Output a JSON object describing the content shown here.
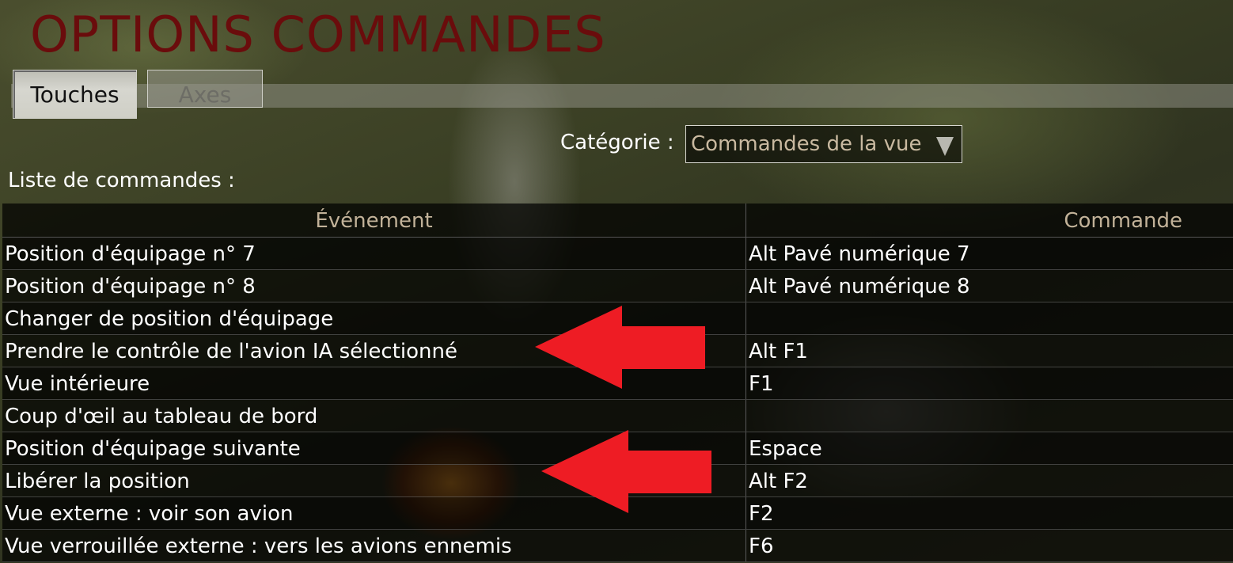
{
  "page": {
    "title": "OPTIONS COMMANDES"
  },
  "tabs": [
    {
      "label": "Touches",
      "active": true
    },
    {
      "label": "Axes",
      "active": false
    }
  ],
  "category": {
    "label": "Catégorie :",
    "selected": "Commandes de la vue"
  },
  "list": {
    "label": "Liste de commandes :"
  },
  "table": {
    "headers": {
      "event": "Événement",
      "command": "Commande"
    },
    "rows": [
      {
        "event": "Position d'équipage n° 7",
        "command": "Alt Pavé numérique 7"
      },
      {
        "event": "Position d'équipage n° 8",
        "command": "Alt Pavé numérique 8"
      },
      {
        "event": "Changer de position d'équipage",
        "command": ""
      },
      {
        "event": "Prendre le contrôle de l'avion IA sélectionné",
        "command": "Alt F1"
      },
      {
        "event": "Vue intérieure",
        "command": "F1"
      },
      {
        "event": "Coup d'œil au tableau de bord",
        "command": ""
      },
      {
        "event": "Position d'équipage suivante",
        "command": "Espace"
      },
      {
        "event": "Libérer la position",
        "command": "Alt F2"
      },
      {
        "event": "Vue externe : voir son avion",
        "command": "F2"
      },
      {
        "event": "Vue verrouillée externe : vers les avions ennemis",
        "command": "F6"
      }
    ]
  },
  "annotations": {
    "arrow_color": "#ee1c24",
    "arrow_icon": "left-arrow-icon"
  },
  "colors": {
    "title": "#6a0c0c",
    "header_text": "#c2b299",
    "select_text": "#c9b9a0"
  }
}
